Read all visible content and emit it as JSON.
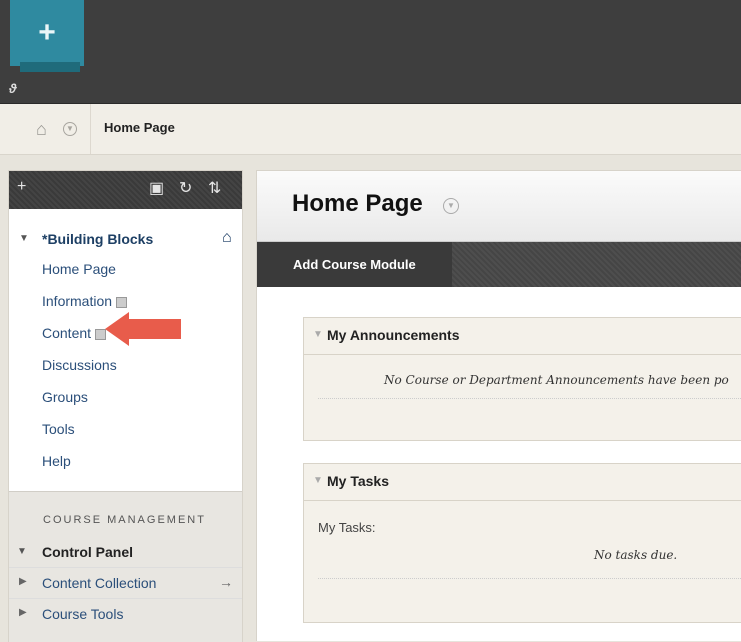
{
  "breadcrumb": {
    "title": "Home Page"
  },
  "left_menu": {
    "course_name": "*Building Blocks",
    "items": [
      {
        "label": "Home Page"
      },
      {
        "label": "Information"
      },
      {
        "label": "Content"
      },
      {
        "label": "Discussions"
      },
      {
        "label": "Groups"
      },
      {
        "label": "Tools"
      },
      {
        "label": "Help"
      }
    ],
    "management_title": "COURSE MANAGEMENT",
    "control_panel": "Control Panel",
    "content_collection": "Content Collection",
    "course_tools": "Course Tools"
  },
  "main": {
    "title": "Home Page",
    "add_module": "Add Course Module",
    "announcements_title": "My Announcements",
    "announcements_text": "No Course or Department Announcements have been po",
    "tasks_title": "My Tasks",
    "tasks_label": "My Tasks:",
    "tasks_text": "No tasks due."
  },
  "colors": {
    "accent": "#2f8aa0",
    "arrow": "#e85c4b"
  }
}
